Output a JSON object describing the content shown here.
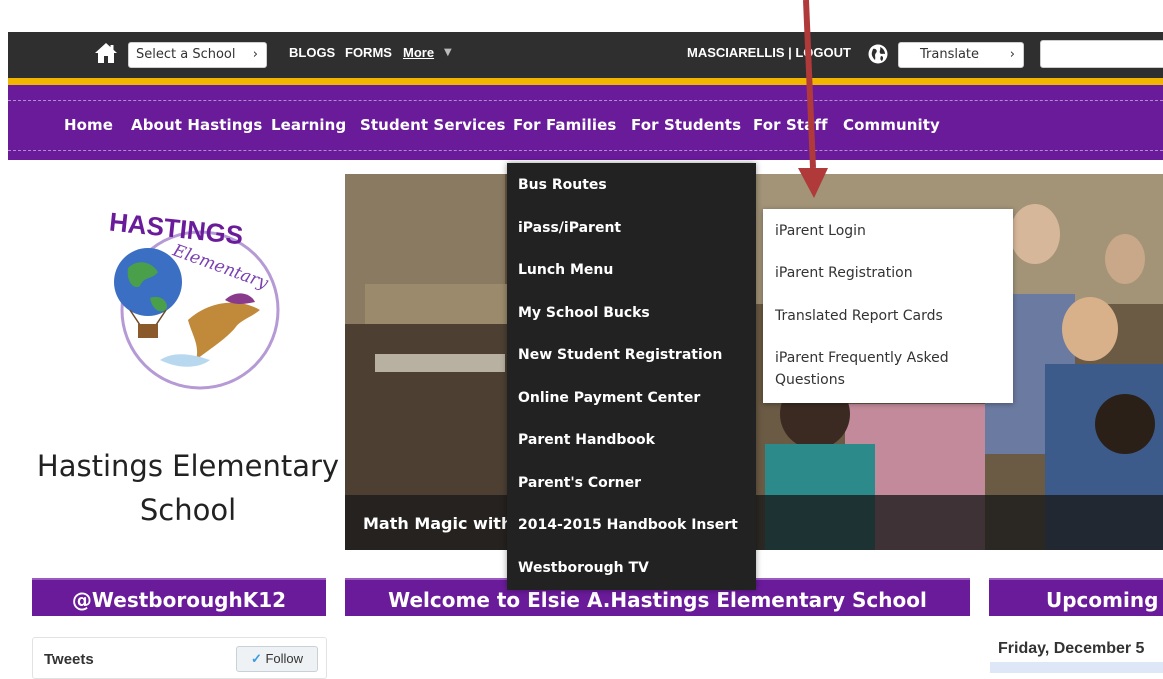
{
  "topbar": {
    "select_school": "Select a School",
    "links": [
      "BLOGS",
      "FORMS",
      "More"
    ],
    "user_logout": "MASCIARELLIS | LOGOUT",
    "translate": "Translate"
  },
  "nav": {
    "items": [
      "Home",
      "About Hastings",
      "Learning",
      "Student Services",
      "For Families",
      "For Students",
      "For Staff",
      "Community"
    ]
  },
  "logo": {
    "text_line1": "HASTINGS",
    "text_line2": "Elementary"
  },
  "school_name": [
    "Hastings Elementary",
    "School"
  ],
  "hero": {
    "caption": "Math Magic with"
  },
  "dropdown": {
    "items": [
      "Bus Routes",
      "iPass/iParent",
      "Lunch Menu",
      "My School Bucks",
      "New Student Registration",
      "Online Payment Center",
      "Parent Handbook",
      "Parent's Corner",
      "2014-2015 Handbook Insert",
      "Westborough TV"
    ]
  },
  "submenu": {
    "items": [
      "iParent Login",
      "iParent Registration",
      "Translated Report Cards",
      "iParent Frequently Asked Questions"
    ]
  },
  "bands": {
    "twitter": "@WestboroughK12",
    "welcome": "Welcome to Elsie A.Hastings Elementary School",
    "upcoming": "Upcoming E"
  },
  "tweets": {
    "label": "Tweets",
    "follow": "Follow"
  },
  "events": {
    "date": "Friday, December 5"
  },
  "colors": {
    "purple": "#6a1b9a",
    "gold": "#f2b600",
    "dark": "#2f2f2f",
    "arrow": "#b03a3a"
  }
}
